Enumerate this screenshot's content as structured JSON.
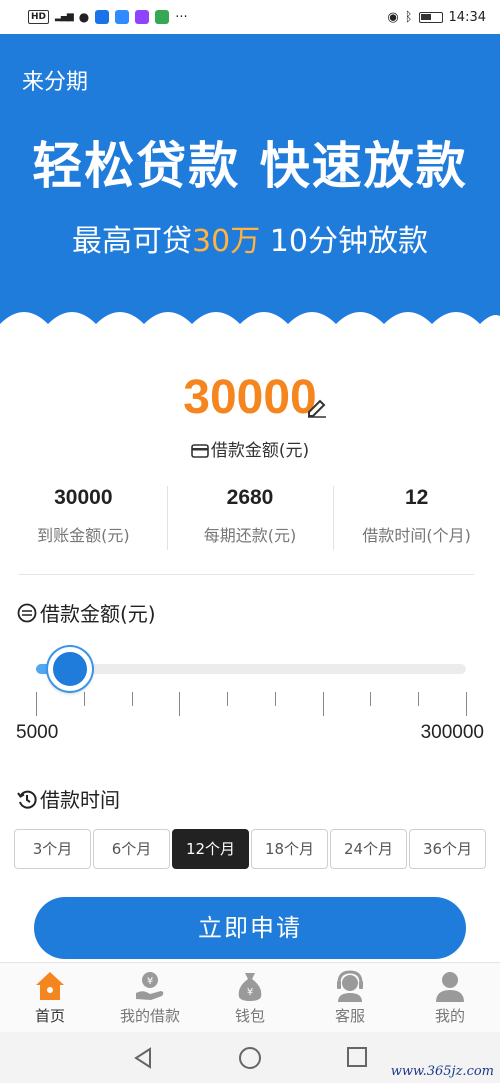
{
  "status_bar": {
    "left_tags": [
      "HD",
      "4G"
    ],
    "time": "14:34",
    "more": "···"
  },
  "header": {
    "app_name": "来分期",
    "hero_title": "轻松贷款 快速放款",
    "hero_sub_a": "最高可贷",
    "hero_sub_highlight": "30万",
    "hero_sub_b": " 10分钟放款"
  },
  "amount": {
    "value": "30000",
    "caption": "借款金额(元)",
    "icon": "edit-icon"
  },
  "stats": [
    {
      "value": "30000",
      "label": "到账金额(元)"
    },
    {
      "value": "2680",
      "label": "每期还款(元)"
    },
    {
      "value": "12",
      "label": "借款时间(个月)"
    }
  ],
  "slider": {
    "title": "借款金额(元)",
    "min_label": "5000",
    "max_label": "300000",
    "level": 0.05
  },
  "term": {
    "title": "借款时间",
    "options": [
      "3个月",
      "6个月",
      "12个月",
      "18个月",
      "24个月",
      "36个月"
    ],
    "selected": "12个月"
  },
  "apply_button": "立即申请",
  "nav": [
    {
      "label": "首页",
      "icon": "home-icon"
    },
    {
      "label": "我的借款",
      "icon": "loan-hand-icon"
    },
    {
      "label": "钱包",
      "icon": "money-bag-icon"
    },
    {
      "label": "客服",
      "icon": "customer-service-icon"
    },
    {
      "label": "我的",
      "icon": "user-icon"
    }
  ],
  "watermark": "www.365jz.com",
  "colors": {
    "primary": "#1f7cdb",
    "accent": "#f5861f",
    "highlight": "#ffb340"
  }
}
